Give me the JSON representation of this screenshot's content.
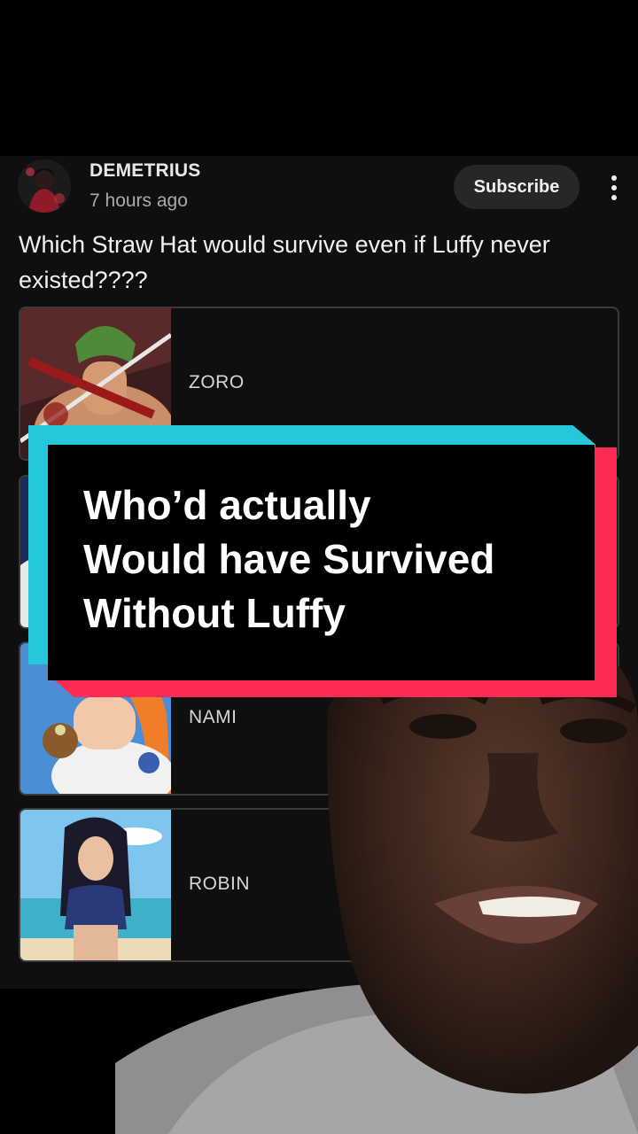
{
  "post": {
    "author": "DEMETRIUS",
    "timestamp": "7 hours ago",
    "subscribe_label": "Subscribe",
    "question": "Which Straw Hat would survive even if Luffy never existed????",
    "options": [
      {
        "label": "ZORO"
      },
      {
        "label": ""
      },
      {
        "label": "NAMI"
      },
      {
        "label": "ROBIN"
      }
    ]
  },
  "overlay": {
    "caption_lines": [
      "Who’d actually",
      "Would have Survived",
      "Without Luffy"
    ],
    "colors": {
      "cyan": "#25c7da",
      "pink": "#fe2c55",
      "card": "#000000"
    }
  },
  "icons": {
    "more": "more-vertical-icon"
  }
}
